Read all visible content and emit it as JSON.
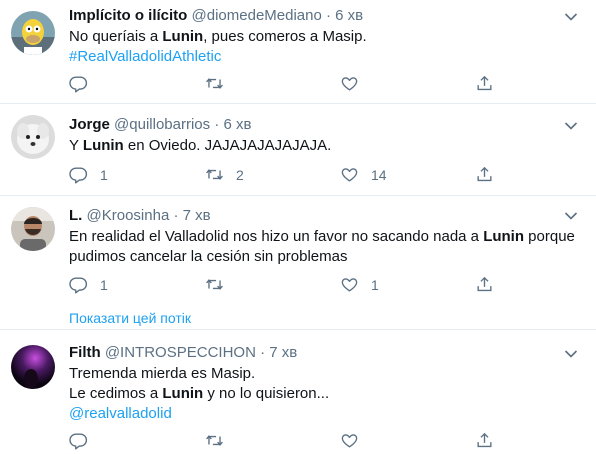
{
  "tweets": [
    {
      "name": "Implícito o ilícito",
      "handle": "@diomedeMediano",
      "dot": "·",
      "time": "6 хв",
      "lines": [
        {
          "pre": "No queríais a ",
          "bold": "Lunin",
          "post": ", pues comeros a Masip."
        },
        {
          "link": "#RealValladolidAthletic"
        }
      ],
      "reply": "",
      "retweet": "",
      "like": ""
    },
    {
      "name": "Jorge",
      "handle": "@quillobarrios",
      "dot": "·",
      "time": "6 хв",
      "lines": [
        {
          "pre": "Y ",
          "bold": "Lunin",
          "post": " en Oviedo. JAJAJAJAJAJAJA."
        }
      ],
      "reply": "1",
      "retweet": "2",
      "like": "14"
    },
    {
      "name": "L.",
      "handle": "@Kroosinha",
      "dot": "·",
      "time": "7 хв",
      "lines": [
        {
          "pre": "En realidad el Valladolid nos hizo un favor no sacando nada a ",
          "bold": "Lunin",
          "post": " porque"
        },
        {
          "pre": "pudimos cancelar la cesión sin problemas"
        }
      ],
      "reply": "1",
      "retweet": "",
      "like": "1"
    },
    {
      "name": "Filth",
      "handle": "@INTROSPECCIHON",
      "dot": "·",
      "time": "7 хв",
      "lines": [
        {
          "pre": "Tremenda mierda es Masip."
        },
        {
          "pre": "Le cedimos a ",
          "bold": "Lunin",
          "post": " y no lo quisieron..."
        },
        {
          "link": "@realvalladolid"
        }
      ],
      "reply": "",
      "retweet": "",
      "like": ""
    }
  ],
  "show_thread": "Показати цей потік",
  "colors": {
    "accent": "#1da1f2",
    "muted": "#5b7083",
    "divider": "#e6ecf0"
  },
  "icons": [
    "reply-icon",
    "retweet-icon",
    "like-icon",
    "share-icon",
    "chevron-down-icon"
  ]
}
